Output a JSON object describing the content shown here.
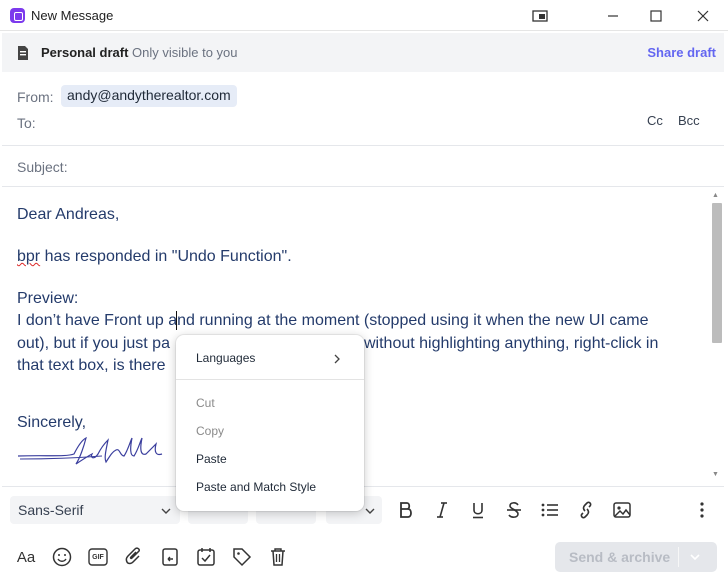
{
  "window": {
    "title": "New Message"
  },
  "draft_bar": {
    "title": "Personal draft",
    "subtitle": "Only visible to you",
    "share_label": "Share draft"
  },
  "header": {
    "from_label": "From:",
    "from_value": "andy@andytherealtor.com",
    "to_label": "To:",
    "cc_label": "Cc",
    "bcc_label": "Bcc",
    "subject_label": "Subject:"
  },
  "body": {
    "greeting": "Dear Andreas,",
    "line1_misspelled": "bpr",
    "line1_rest": " has responded in \"Undo Function\".",
    "preview_label": "Preview:",
    "preview_line1": "I don’t have Front up and running at the moment (stopped using it when the new UI came",
    "preview_line2": "out), but if you just paste without highlighting anything, right-click in",
    "preview_line3": "that text box, is there",
    "closing": "Sincerely,"
  },
  "context_menu": {
    "languages": "Languages",
    "cut": "Cut",
    "copy": "Copy",
    "paste": "Paste",
    "paste_match": "Paste and Match Style"
  },
  "format_bar": {
    "font": "Sans-Serif"
  },
  "bottom_bar": {
    "send_label": "Send & archive",
    "gif_label": "GIF",
    "font_icon_label": "Aa"
  },
  "colors": {
    "accent": "#6366f1",
    "body_text": "#243b6b",
    "signature": "#3b3f9e"
  }
}
